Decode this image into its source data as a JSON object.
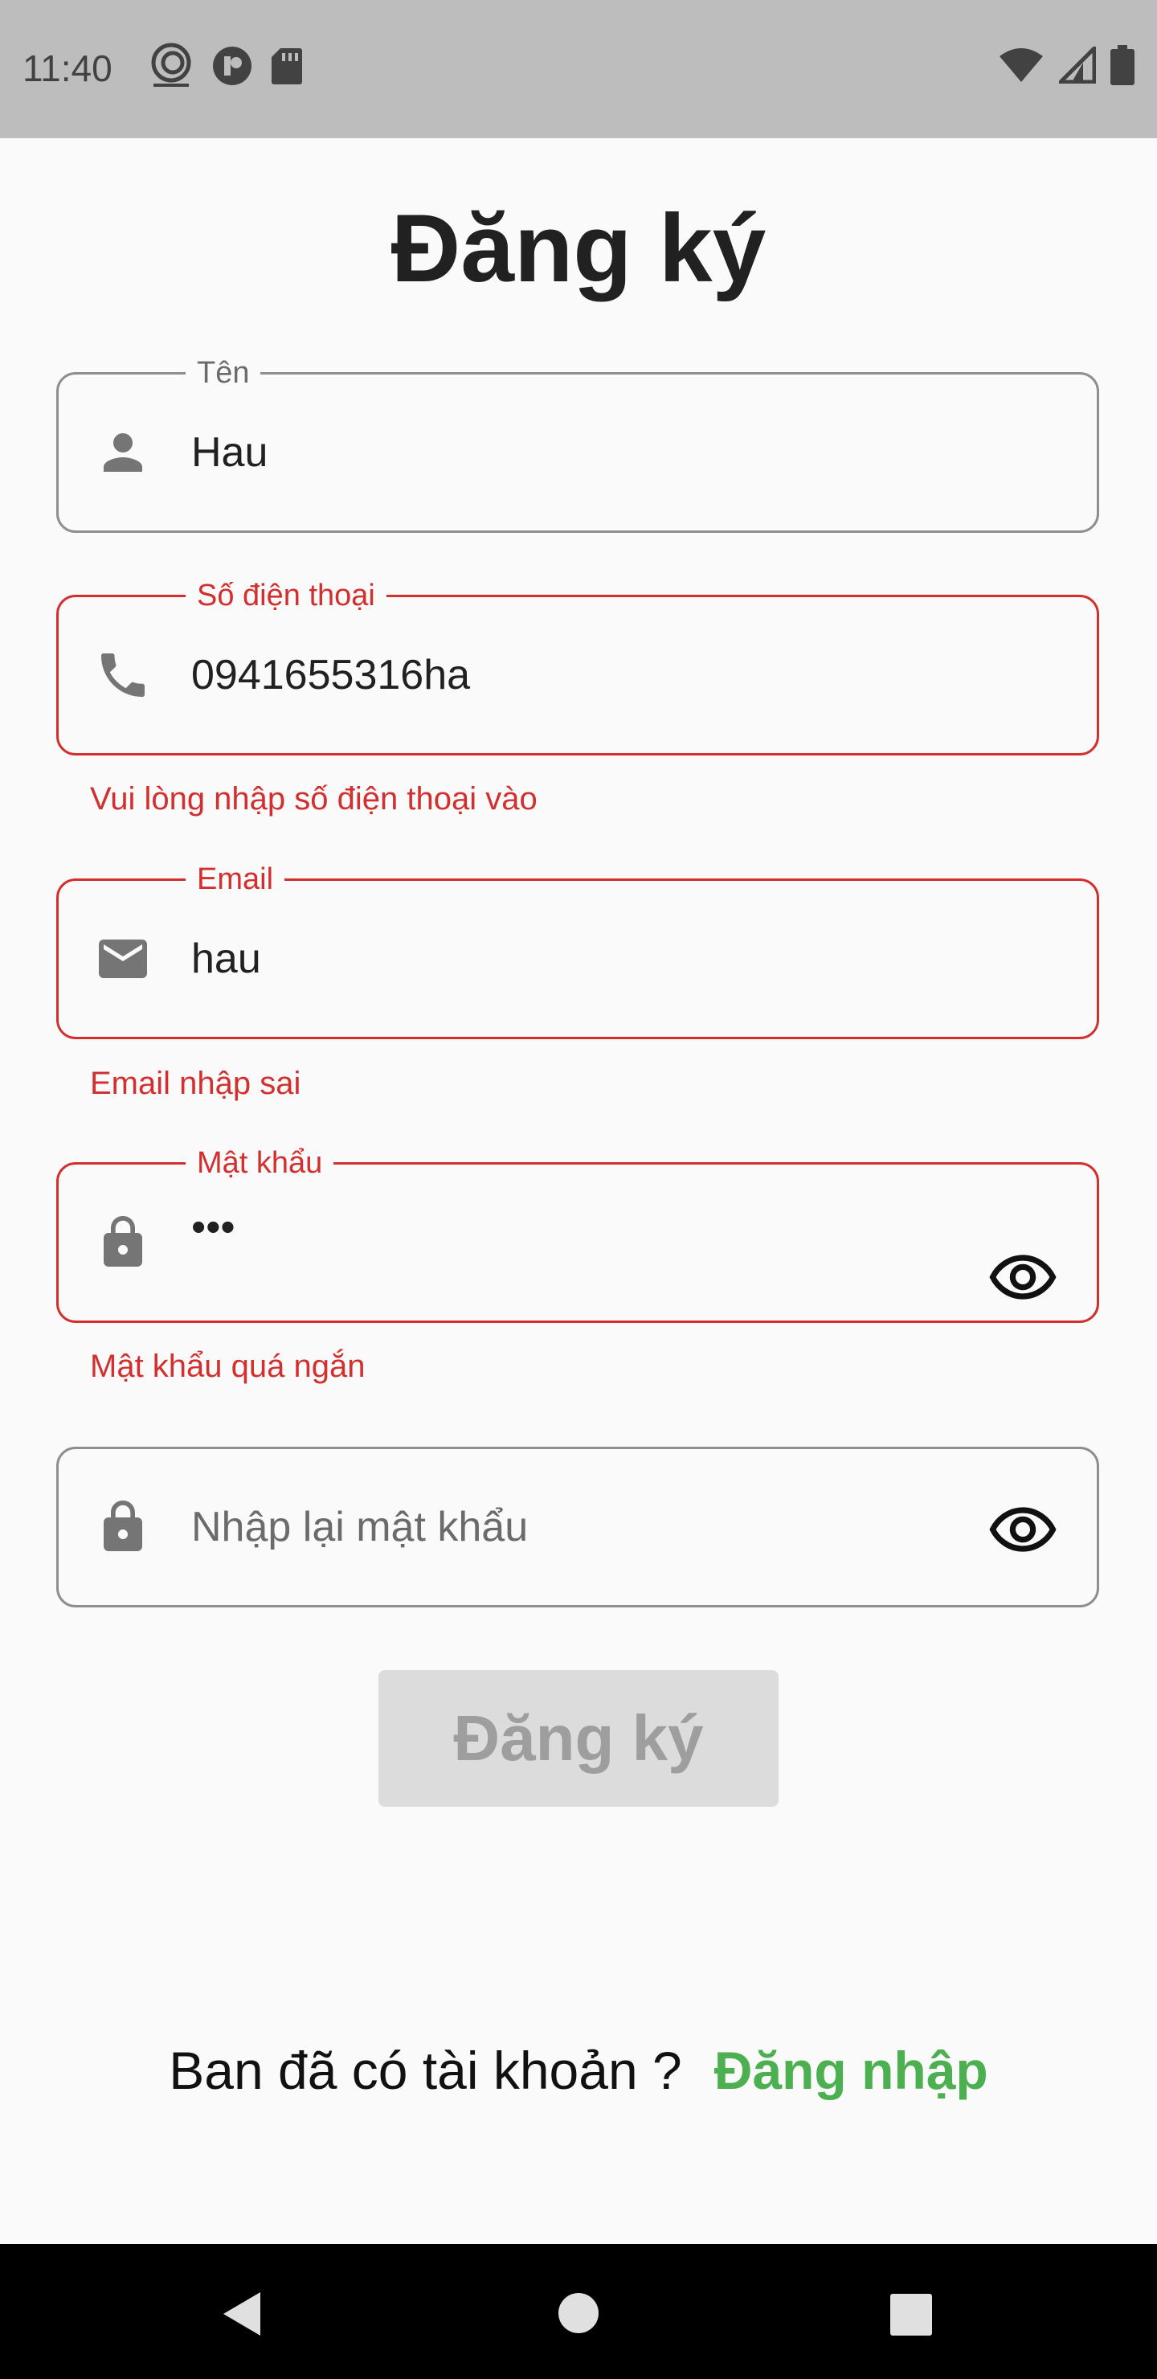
{
  "status_bar": {
    "time": "11:40"
  },
  "page": {
    "title": "Đăng ký"
  },
  "form": {
    "name": {
      "label": "Tên",
      "value": "Hau",
      "icon": "person-icon"
    },
    "phone": {
      "label": "Số điện thoại",
      "value": "0941655316ha",
      "icon": "phone-icon",
      "error": "Vui lòng nhập số điện thoại vào"
    },
    "email": {
      "label": "Email",
      "value": "hau",
      "icon": "email-icon",
      "error": "Email nhập sai"
    },
    "password": {
      "label": "Mật khẩu",
      "value": "•••",
      "icon": "lock-icon",
      "error": "Mật khẩu quá ngắn"
    },
    "confirm_password": {
      "placeholder": "Nhập lại mật khẩu",
      "icon": "lock-icon"
    },
    "submit_label": "Đăng ký"
  },
  "footer": {
    "prompt": "Ban đã có tài khoản ?",
    "login_link": "Đăng nhập"
  },
  "colors": {
    "error": "#d32f2f",
    "link": "#4caf50",
    "status_bar": "#bdbdbd"
  }
}
